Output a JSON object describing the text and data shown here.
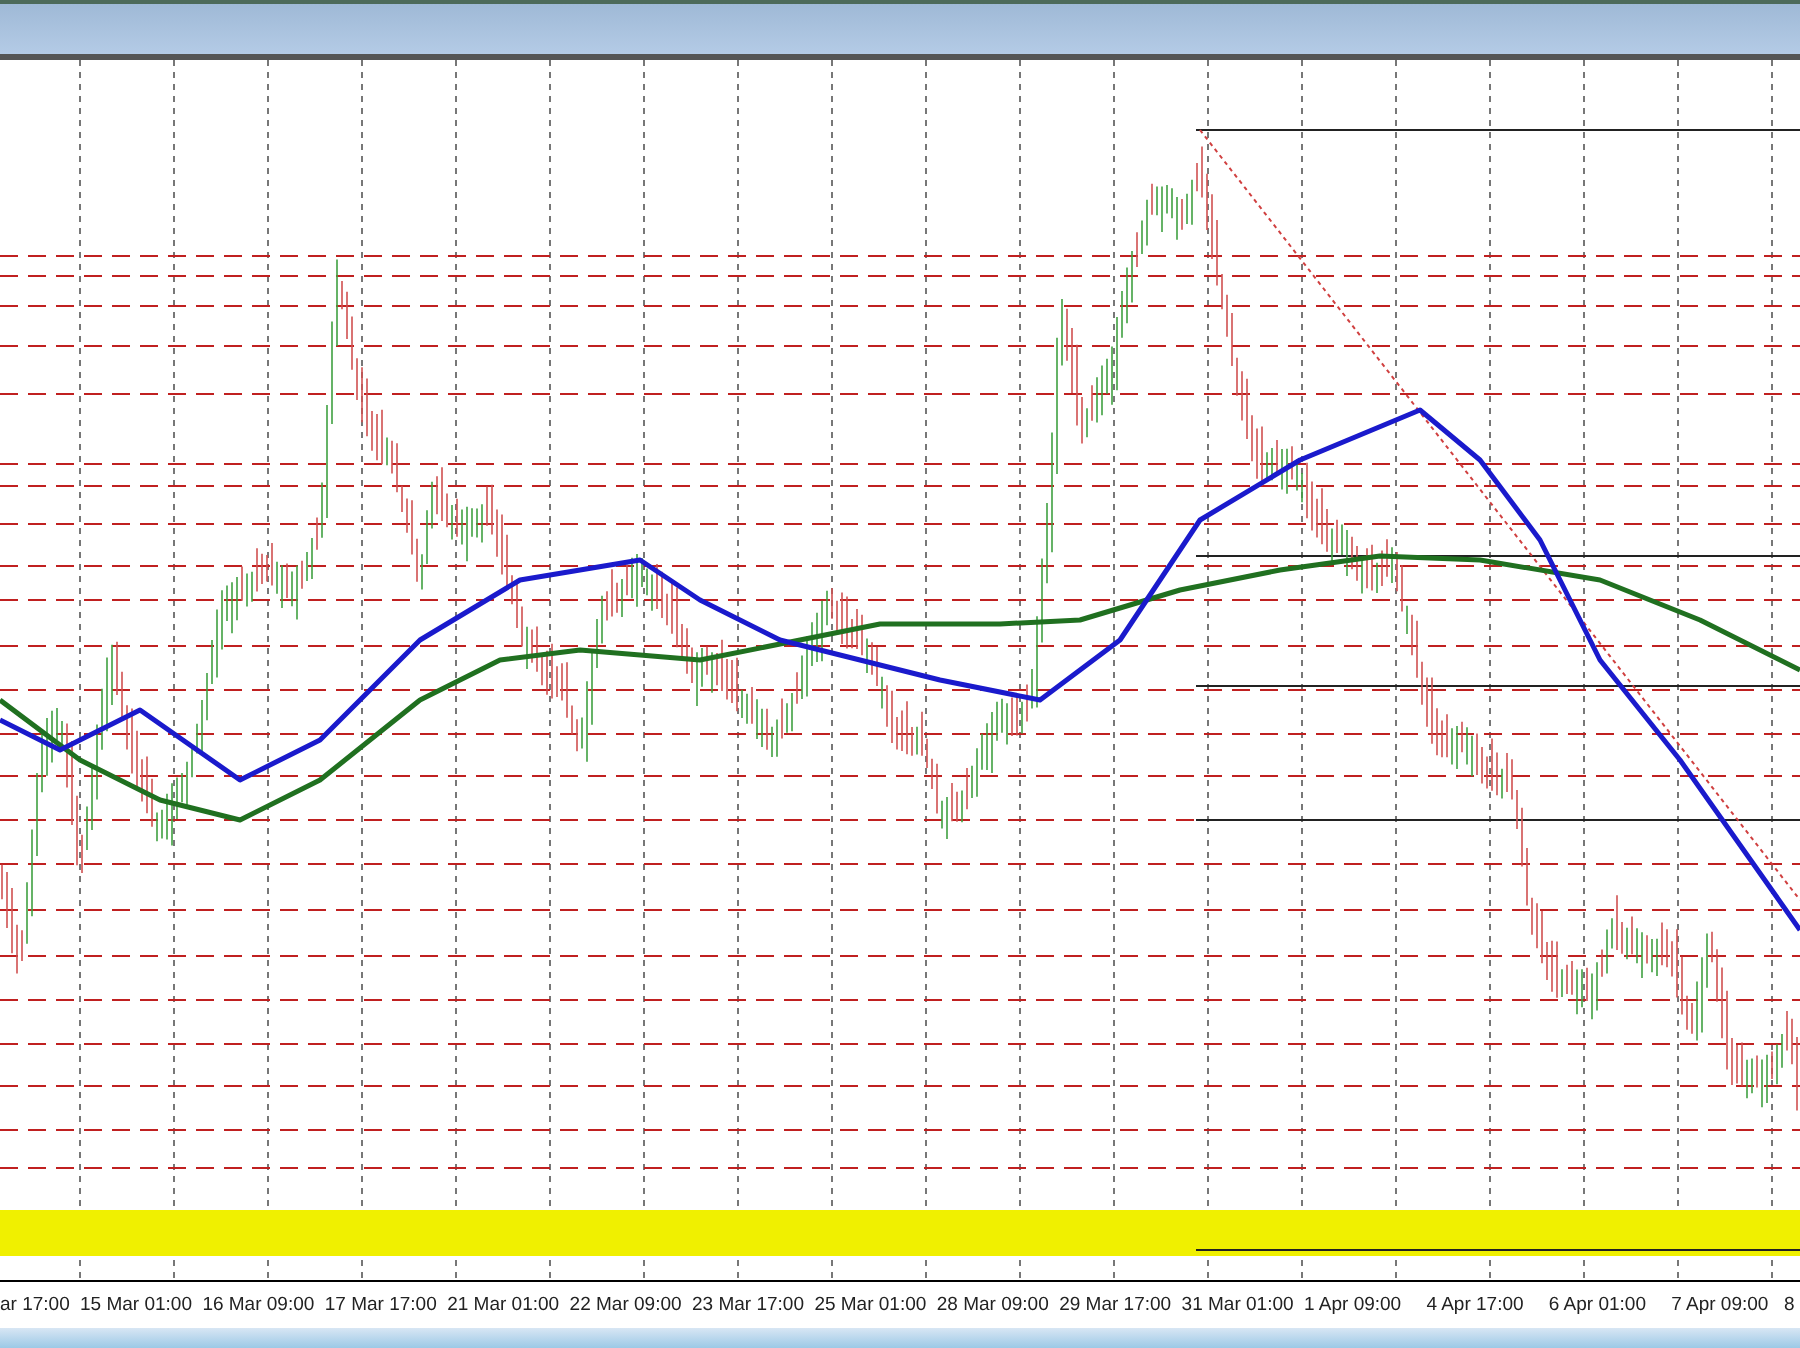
{
  "time_axis": {
    "labels": [
      "ar 17:00",
      "15 Mar 01:00",
      "16 Mar 09:00",
      "17 Mar 17:00",
      "21 Mar 01:00",
      "22 Mar 09:00",
      "23 Mar 17:00",
      "25 Mar 01:00",
      "28 Mar 09:00",
      "29 Mar 17:00",
      "31 Mar 01:00",
      "1 Apr 09:00",
      "4 Apr 17:00",
      "6 Apr 01:00",
      "7 Apr 09:00",
      "8"
    ]
  }
}
